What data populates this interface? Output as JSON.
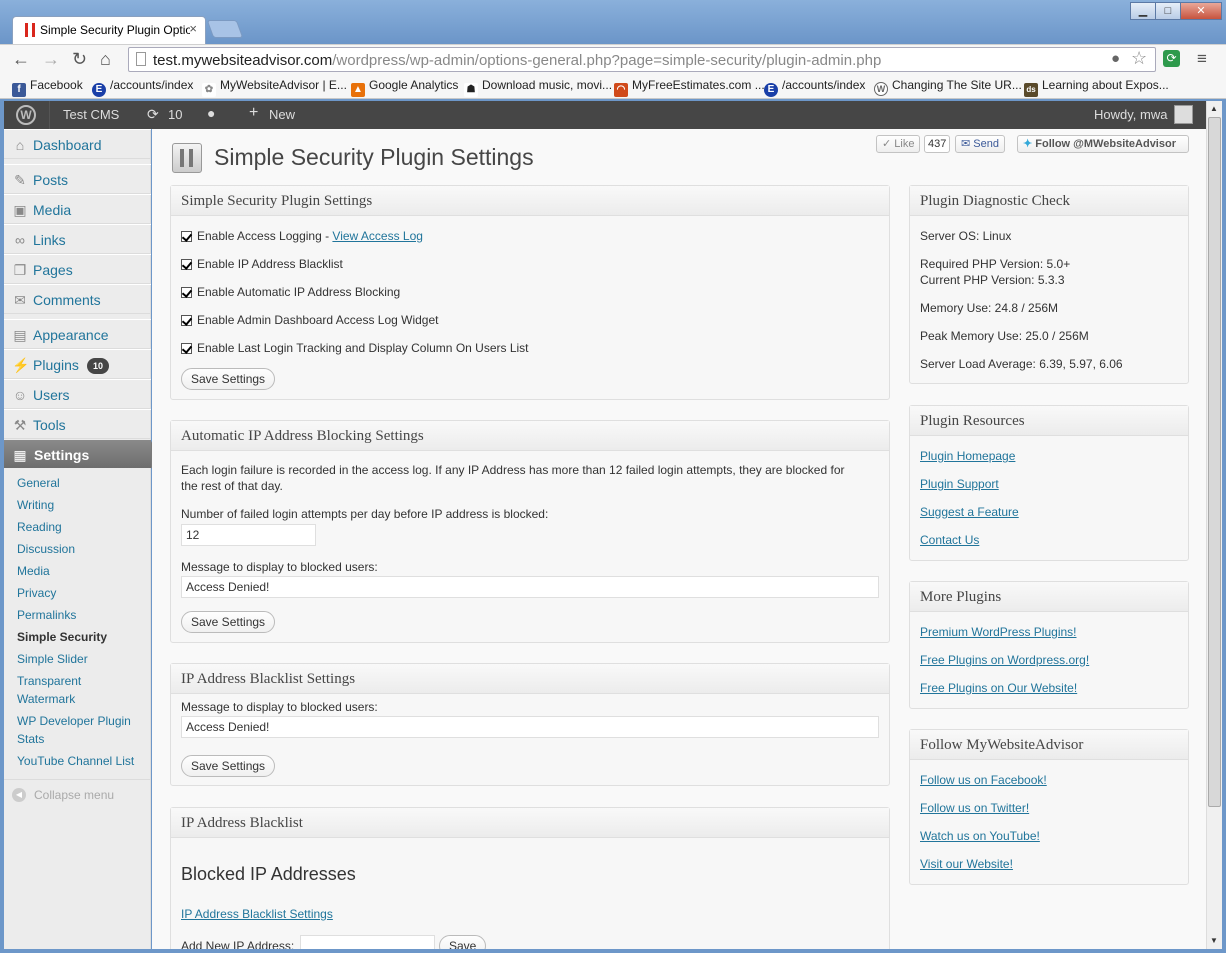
{
  "browser": {
    "tab_title": "Simple Security Plugin Options",
    "tab_close": "×",
    "window_buttons": {
      "minimize": "▁",
      "maximize": "□",
      "close": "✕"
    },
    "url_host": "test.mywebsiteadvisor.com",
    "url_path": "/wordpress/wp-admin/options-general.php?page=simple-security/plugin-admin.php",
    "bookmarks": [
      {
        "label": "Facebook",
        "icon": "facebook-icon",
        "color": "#3b5998",
        "glyph": "f"
      },
      {
        "label": "/accounts/index",
        "icon": "e-icon",
        "color": "#1a3fa8",
        "glyph": "E"
      },
      {
        "label": "MyWebsiteAdvisor | E...",
        "icon": "gear-icon",
        "color": "#888888",
        "glyph": "✿"
      },
      {
        "label": "Google Analytics",
        "icon": "analytics-icon",
        "color": "#e8710a",
        "glyph": "▲"
      },
      {
        "label": "Download music, movi...",
        "icon": "pirate-icon",
        "color": "#222222",
        "glyph": "☗"
      },
      {
        "label": "MyFreeEstimates.com ...",
        "icon": "estimates-icon",
        "color": "#d04a1a",
        "glyph": "◠"
      },
      {
        "label": "/accounts/index",
        "icon": "e-icon",
        "color": "#1a3fa8",
        "glyph": "E"
      },
      {
        "label": "Changing The Site UR...",
        "icon": "wordpress-icon",
        "color": "#666666",
        "glyph": "W"
      },
      {
        "label": "Learning about Expos...",
        "icon": "ds-icon",
        "color": "#5a4a2a",
        "glyph": "ds"
      }
    ]
  },
  "adminbar": {
    "site_name": "Test CMS",
    "updates_count": "10",
    "new_label": "New",
    "howdy": "Howdy, mwa"
  },
  "sidebar": {
    "menu": [
      {
        "label": "Dashboard",
        "icon": "dashboard-icon",
        "glyph": "⌂"
      },
      {
        "label": "Posts",
        "icon": "pin-icon",
        "glyph": "✎"
      },
      {
        "label": "Media",
        "icon": "media-icon",
        "glyph": "▣"
      },
      {
        "label": "Links",
        "icon": "link-icon",
        "glyph": "∞"
      },
      {
        "label": "Pages",
        "icon": "pages-icon",
        "glyph": "❐"
      },
      {
        "label": "Comments",
        "icon": "comment-icon",
        "glyph": "✉"
      },
      {
        "label": "Appearance",
        "icon": "appearance-icon",
        "glyph": "▤"
      },
      {
        "label": "Plugins",
        "icon": "plugin-icon",
        "glyph": "⚡"
      },
      {
        "label": "Users",
        "icon": "users-icon",
        "glyph": "☺"
      },
      {
        "label": "Tools",
        "icon": "tools-icon",
        "glyph": "⚒"
      },
      {
        "label": "Settings",
        "icon": "settings-icon",
        "glyph": "▦"
      }
    ],
    "plugins_badge": "10",
    "submenu": [
      "General",
      "Writing",
      "Reading",
      "Discussion",
      "Media",
      "Privacy",
      "Permalinks",
      "Simple Security",
      "Simple Slider",
      "Transparent",
      "Watermark",
      "WP Developer Plugin",
      "Stats",
      "YouTube Channel List"
    ],
    "collapse": "Collapse menu"
  },
  "header": {
    "title": "Simple Security Plugin Settings",
    "like": "Like",
    "like_count": "437",
    "send": "Send",
    "follow": "Follow @MWebsiteAdvisor"
  },
  "settings_box": {
    "title": "Simple Security Plugin Settings",
    "opt1": "Enable Access Logging - ",
    "opt1_link": "View Access Log",
    "opt2": "Enable IP Address Blacklist",
    "opt3": "Enable Automatic IP Address Blocking",
    "opt4": "Enable Admin Dashboard Access Log Widget",
    "opt5": "Enable Last Login Tracking and Display Column On Users List",
    "save": "Save Settings"
  },
  "auto_box": {
    "title": "Automatic IP Address Blocking Settings",
    "desc1": "Each login failure is recorded in the access log. If any IP Address has more than 12 failed login attempts, they are blocked for",
    "desc2": "the rest of that day.",
    "attempts_label": "Number of failed login attempts per day before IP address is blocked:",
    "attempts_value": "12",
    "message_label": "Message to display to blocked users:",
    "message_value": "Access Denied!",
    "save": "Save Settings"
  },
  "blacklist_settings_box": {
    "title": "IP Address Blacklist Settings",
    "message_label": "Message to display to blocked users:",
    "message_value": "Access Denied!",
    "save": "Save Settings"
  },
  "blacklist_box": {
    "title": "IP Address Blacklist",
    "heading": "Blocked IP Addresses",
    "link": "IP Address Blacklist Settings",
    "add_label": "Add New IP Address:",
    "save": "Save"
  },
  "diagnostic": {
    "title": "Plugin Diagnostic Check",
    "server_os": "Server OS: Linux",
    "req_php": "Required PHP Version: 5.0+",
    "cur_php": "Current PHP Version: 5.3.3",
    "memory": "Memory Use: 24.8 / 256M",
    "peak": "Peak Memory Use: 25.0 / 256M",
    "load": "Server Load Average: 6.39, 5.97, 6.06"
  },
  "resources": {
    "title": "Plugin Resources",
    "links": [
      "Plugin Homepage",
      "Plugin Support",
      "Suggest a Feature",
      "Contact Us"
    ]
  },
  "more_plugins": {
    "title": "More Plugins",
    "links": [
      "Premium WordPress Plugins!",
      "Free Plugins on Wordpress.org!",
      "Free Plugins on Our Website!"
    ]
  },
  "follow": {
    "title": "Follow MyWebsiteAdvisor",
    "links": [
      "Follow us on Facebook!",
      "Follow us on Twitter!",
      "Watch us on YouTube!",
      "Visit our Website!"
    ]
  }
}
